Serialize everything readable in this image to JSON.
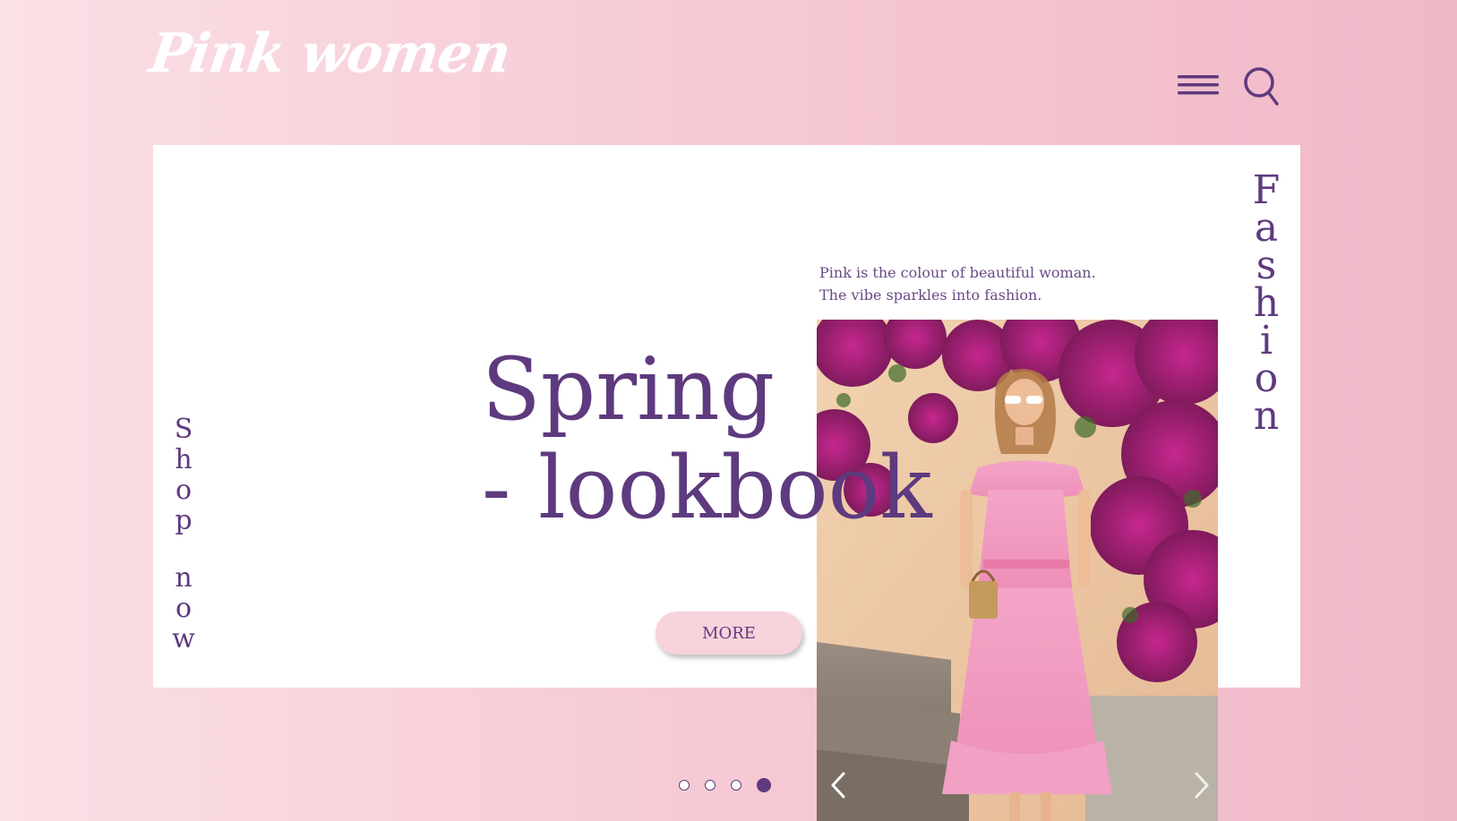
{
  "brand": {
    "logo_text": "Pink women"
  },
  "header": {
    "menu_icon": "hamburger-icon",
    "search_icon": "search-icon"
  },
  "side_labels": {
    "left_word_1": [
      "S",
      "h",
      "o",
      "p"
    ],
    "left_word_2": [
      "n",
      "o",
      "w"
    ],
    "right": [
      "F",
      "a",
      "s",
      "h",
      "i",
      "o",
      "n"
    ]
  },
  "hero": {
    "headline_line_1": "Spring",
    "headline_line_2": "- lookbook",
    "tagline_line_1": "Pink is the colour of beautiful woman.",
    "tagline_line_2": "The vibe sparkles into fashion.",
    "more_label": "MORE"
  },
  "carousel": {
    "prev_icon": "chevron-left-icon",
    "next_icon": "chevron-right-icon",
    "dots": 4,
    "active_dot": 4
  },
  "colors": {
    "accent": "#5e3a7e",
    "button_bg": "#f7d3dc",
    "background_start": "#fbe0e6",
    "background_end": "#f1b8c8"
  }
}
